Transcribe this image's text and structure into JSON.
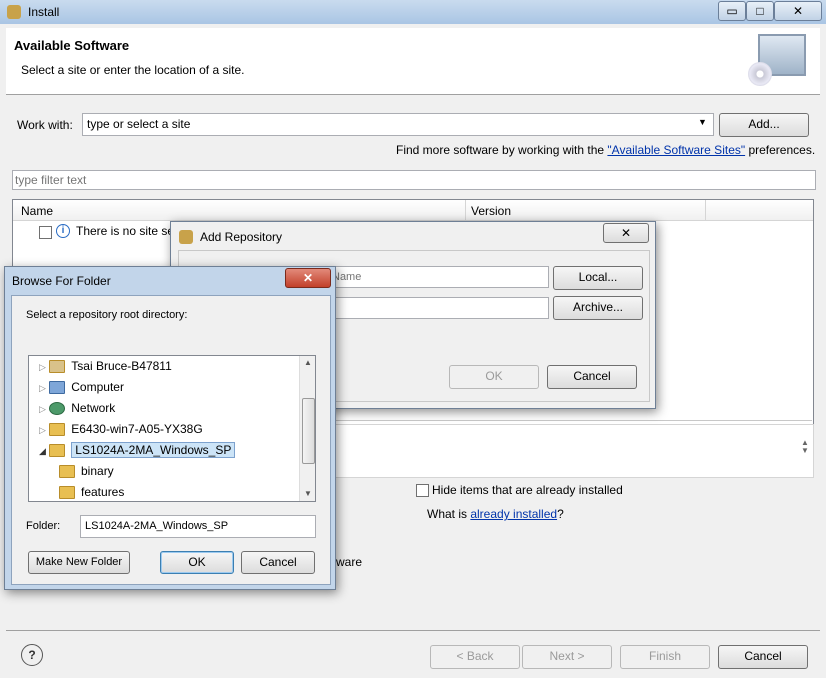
{
  "window": {
    "title": "Install",
    "minimize": "▭",
    "maximize": "□",
    "close": "✕"
  },
  "header": {
    "title": "Available Software",
    "subtitle": "Select a site or enter the location of a site."
  },
  "work_with": {
    "label": "Work with:",
    "value": "type or select a site",
    "add_label": "Add..."
  },
  "find_more": {
    "prefix": "Find more software by working with the ",
    "link": "\"Available Software Sites\"",
    "suffix": " preferences."
  },
  "filter": {
    "placeholder": "type filter text"
  },
  "table": {
    "col_name": "Name",
    "col_version": "Version",
    "row_text": "There is no site sel"
  },
  "options": {
    "hide_installed": "Hide items that are already installed",
    "what_is_prefix": "What is ",
    "what_is_link": "already installed",
    "what_is_suffix": "?",
    "partial_ware": "ware"
  },
  "footer": {
    "back": "< Back",
    "next": "Next >",
    "finish": "Finish",
    "cancel": "Cancel"
  },
  "add_repository": {
    "title": "Add Repository",
    "name_placeholder": "Name",
    "local": "Local...",
    "archive": "Archive...",
    "ok": "OK",
    "cancel": "Cancel"
  },
  "browse": {
    "title": "Browse For Folder",
    "prompt": "Select a repository root directory:",
    "items": [
      "Tsai Bruce-B47811",
      "Computer",
      "Network",
      "E6430-win7-A05-YX38G",
      "LS1024A-2MA_Windows_SP",
      "binary",
      "features"
    ],
    "folder_label": "Folder:",
    "folder_value": "LS1024A-2MA_Windows_SP",
    "make_new": "Make New Folder",
    "ok": "OK",
    "cancel": "Cancel"
  }
}
